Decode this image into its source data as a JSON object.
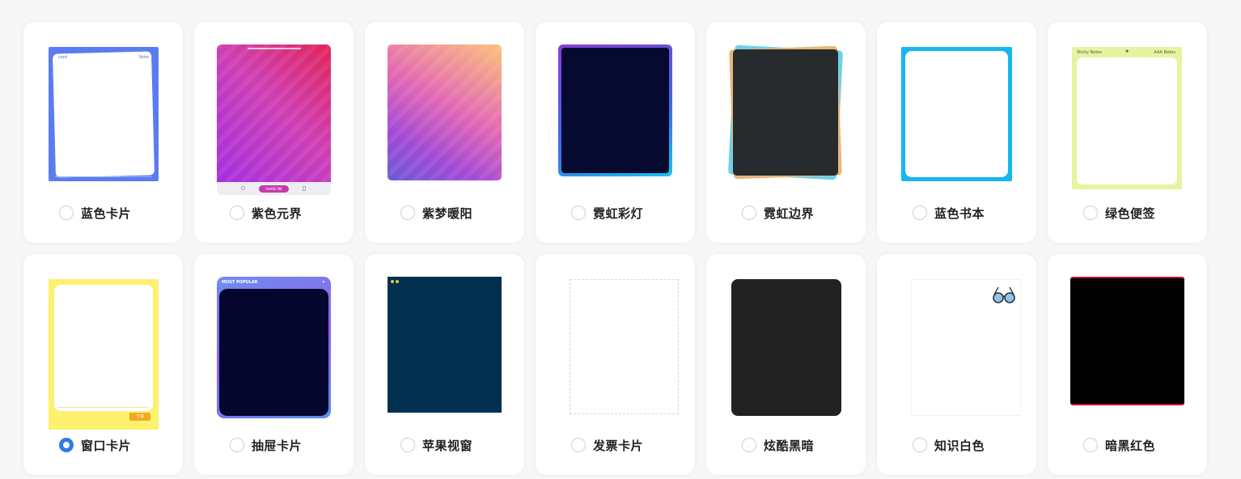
{
  "templates": [
    {
      "label": "蓝色卡片",
      "selected": false,
      "thumb_text": [
        "card",
        "Note"
      ]
    },
    {
      "label": "紫色元界",
      "selected": false,
      "thumb_text": [
        "SHARE ME"
      ]
    },
    {
      "label": "紫梦暖阳",
      "selected": false
    },
    {
      "label": "霓虹彩灯",
      "selected": false
    },
    {
      "label": "霓虹边界",
      "selected": false
    },
    {
      "label": "蓝色书本",
      "selected": false
    },
    {
      "label": "绿色便签",
      "selected": false,
      "thumb_text": [
        "Sticky Notes",
        "✱",
        "AAA Notes"
      ]
    },
    {
      "label": "窗口卡片",
      "selected": true,
      "thumb_text": [
        "下载"
      ]
    },
    {
      "label": "抽屉卡片",
      "selected": false,
      "thumb_text": [
        "MOST POPULAR",
        "✦"
      ]
    },
    {
      "label": "苹果视窗",
      "selected": false
    },
    {
      "label": "发票卡片",
      "selected": false
    },
    {
      "label": "炫酷黑暗",
      "selected": false
    },
    {
      "label": "知识白色",
      "selected": false
    },
    {
      "label": "暗黑红色",
      "selected": false
    }
  ],
  "colors": {
    "accent": "#2c7ce6"
  }
}
